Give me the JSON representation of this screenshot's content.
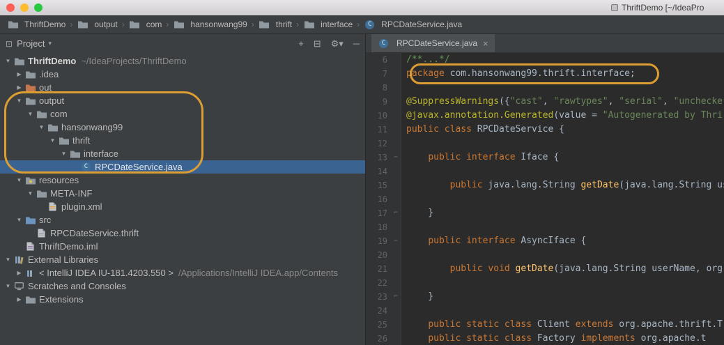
{
  "window": {
    "title": "ThriftDemo [~/IdeaPro"
  },
  "breadcrumb_separator": "›",
  "breadcrumbs": [
    {
      "label": "ThriftDemo",
      "icon": "project-folder-icon"
    },
    {
      "label": "output",
      "icon": "folder-icon"
    },
    {
      "label": "com",
      "icon": "folder-icon"
    },
    {
      "label": "hansonwang99",
      "icon": "folder-icon"
    },
    {
      "label": "thrift",
      "icon": "folder-icon"
    },
    {
      "label": "interface",
      "icon": "folder-icon"
    },
    {
      "label": "RPCDateService.java",
      "icon": "java-class-icon"
    }
  ],
  "project_panel": {
    "title": "Project",
    "header_icons": [
      "locate-icon",
      "collapse-all-icon",
      "settings-icon",
      "hide-icon"
    ],
    "tree": [
      {
        "label": "ThriftDemo",
        "hint": "~/IdeaProjects/ThriftDemo",
        "icon": "project-folder-icon",
        "indent": 0,
        "state": "expanded",
        "bold": true
      },
      {
        "label": ".idea",
        "icon": "folder-icon",
        "indent": 1,
        "state": "collapsed"
      },
      {
        "label": "out",
        "icon": "excluded-folder-icon",
        "indent": 1,
        "state": "collapsed"
      },
      {
        "label": "output",
        "icon": "folder-icon",
        "indent": 1,
        "state": "expanded"
      },
      {
        "label": "com",
        "icon": "folder-icon",
        "indent": 2,
        "state": "expanded"
      },
      {
        "label": "hansonwang99",
        "icon": "folder-icon",
        "indent": 3,
        "state": "expanded"
      },
      {
        "label": "thrift",
        "icon": "folder-icon",
        "indent": 4,
        "state": "expanded"
      },
      {
        "label": "interface",
        "icon": "folder-icon",
        "indent": 5,
        "state": "expanded"
      },
      {
        "label": "RPCDateService.java",
        "icon": "java-class-icon",
        "indent": 6,
        "state": "leaf",
        "selected": true
      },
      {
        "label": "resources",
        "icon": "resources-folder-icon",
        "indent": 1,
        "state": "expanded"
      },
      {
        "label": "META-INF",
        "icon": "folder-icon",
        "indent": 2,
        "state": "expanded"
      },
      {
        "label": "plugin.xml",
        "icon": "xml-file-icon",
        "indent": 3,
        "state": "leaf"
      },
      {
        "label": "src",
        "icon": "source-folder-icon",
        "indent": 1,
        "state": "expanded"
      },
      {
        "label": "RPCDateService.thrift",
        "icon": "text-file-icon",
        "indent": 2,
        "state": "leaf"
      },
      {
        "label": "ThriftDemo.iml",
        "icon": "iml-file-icon",
        "indent": 1,
        "state": "leaf"
      },
      {
        "label": "External Libraries",
        "icon": "libraries-icon",
        "indent": 0,
        "state": "expanded"
      },
      {
        "label": "< IntelliJ IDEA IU-181.4203.550 >",
        "hint": "/Applications/IntelliJ IDEA.app/Contents",
        "icon": "library-icon",
        "indent": 1,
        "state": "collapsed"
      },
      {
        "label": "Scratches and Consoles",
        "icon": "scratches-icon",
        "indent": 0,
        "state": "expanded"
      },
      {
        "label": "Extensions",
        "icon": "folder-icon",
        "indent": 1,
        "state": "collapsed"
      }
    ]
  },
  "editor": {
    "tab": {
      "label": "RPCDateService.java",
      "icon": "java-class-icon",
      "close_glyph": "×"
    },
    "lines": [
      {
        "n": 6,
        "segs": [
          [
            "/**...*/",
            "c"
          ]
        ]
      },
      {
        "n": 7,
        "annotated": true,
        "segs": [
          [
            "package ",
            "k"
          ],
          [
            "com.hansonwang99.thrift.interface;",
            "d"
          ]
        ]
      },
      {
        "n": 8,
        "segs": []
      },
      {
        "n": 9,
        "segs": [
          [
            "@SuppressWarnings",
            "a"
          ],
          [
            "({",
            "d"
          ],
          [
            "\"cast\"",
            "s"
          ],
          [
            ", ",
            "d"
          ],
          [
            "\"rawtypes\"",
            "s"
          ],
          [
            ", ",
            "d"
          ],
          [
            "\"serial\"",
            "s"
          ],
          [
            ", ",
            "d"
          ],
          [
            "\"unchecke",
            "s"
          ]
        ]
      },
      {
        "n": 10,
        "segs": [
          [
            "@javax.annotation.Generated",
            "a"
          ],
          [
            "(value = ",
            "d"
          ],
          [
            "\"Autogenerated by Thri",
            "s"
          ]
        ]
      },
      {
        "n": 11,
        "segs": [
          [
            "public class ",
            "k"
          ],
          [
            "RPCDateService {",
            "d"
          ]
        ]
      },
      {
        "n": 12,
        "segs": []
      },
      {
        "n": 13,
        "fold": "start",
        "segs": [
          [
            "    ",
            "d"
          ],
          [
            "public interface ",
            "k"
          ],
          [
            "Iface {",
            "d"
          ]
        ]
      },
      {
        "n": 14,
        "segs": []
      },
      {
        "n": 15,
        "segs": [
          [
            "        ",
            "d"
          ],
          [
            "public ",
            "k"
          ],
          [
            "java.lang.String ",
            "d"
          ],
          [
            "getDate",
            "m"
          ],
          [
            "(java.lang.String use",
            "d"
          ]
        ]
      },
      {
        "n": 16,
        "segs": []
      },
      {
        "n": 17,
        "fold": "end",
        "segs": [
          [
            "    }",
            "d"
          ]
        ]
      },
      {
        "n": 18,
        "segs": []
      },
      {
        "n": 19,
        "fold": "start",
        "segs": [
          [
            "    ",
            "d"
          ],
          [
            "public interface ",
            "k"
          ],
          [
            "AsyncIface {",
            "d"
          ]
        ]
      },
      {
        "n": 20,
        "segs": []
      },
      {
        "n": 21,
        "segs": [
          [
            "        ",
            "d"
          ],
          [
            "public void ",
            "k"
          ],
          [
            "getDate",
            "m"
          ],
          [
            "(java.lang.String userName, org.apa",
            "d"
          ]
        ]
      },
      {
        "n": 22,
        "segs": []
      },
      {
        "n": 23,
        "fold": "end",
        "segs": [
          [
            "    }",
            "d"
          ]
        ]
      },
      {
        "n": 24,
        "segs": []
      },
      {
        "n": 25,
        "segs": [
          [
            "    ",
            "d"
          ],
          [
            "public static class ",
            "k"
          ],
          [
            "Client ",
            "d"
          ],
          [
            "extends ",
            "k"
          ],
          [
            "org.apache.thrift.T",
            "d"
          ]
        ]
      },
      {
        "n": 26,
        "segs": [
          [
            "    ",
            "d"
          ],
          [
            "public static class ",
            "k"
          ],
          [
            "Factory ",
            "d"
          ],
          [
            "implements ",
            "k"
          ],
          [
            "org.apache.t",
            "d"
          ]
        ]
      }
    ]
  },
  "colors": {
    "selection_blue": "#3A6392",
    "annotation_orange": "#DC9E33",
    "keyword": "#CC7832",
    "string": "#6A8759",
    "annotation_yellow": "#BBB529",
    "method": "#FFC66D",
    "comment": "#629755",
    "code_default": "#A9B7C6",
    "editor_bg": "#2B2B2B",
    "gutter_fg": "#606366",
    "tl_red": "#FF5F57",
    "tl_yellow": "#FEBC2E",
    "tl_green": "#28C840"
  }
}
